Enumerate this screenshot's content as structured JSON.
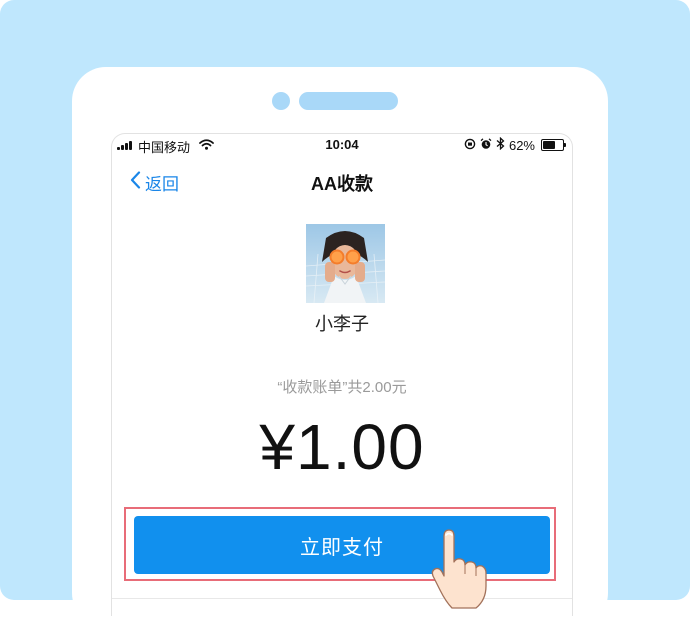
{
  "status_bar": {
    "carrier": "中国移动",
    "time": "10:04",
    "battery_text": "62%",
    "battery_level": 0.62,
    "icons": [
      "signal-icon",
      "wifi-icon",
      "rotation-lock-icon",
      "alarm-icon",
      "bluetooth-icon",
      "battery-icon"
    ]
  },
  "nav": {
    "back_label": "返回",
    "title": "AA收款"
  },
  "payee": {
    "name": "小李子"
  },
  "bill": {
    "description": "“收款账单”共2.00元",
    "amount": "¥1.00"
  },
  "actions": {
    "pay_label": "立即支付"
  },
  "colors": {
    "backdrop": "#bfe7fd",
    "accent": "#1190ee",
    "link": "#1a86e8",
    "highlight": "#e86c78"
  }
}
